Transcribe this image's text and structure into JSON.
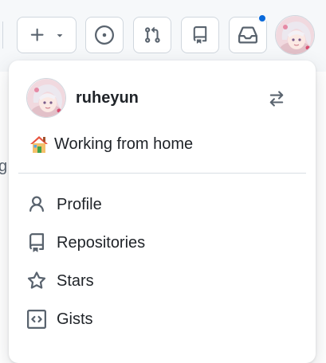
{
  "user": {
    "username": "ruheyun",
    "status": "Working from home",
    "status_emoji": "house-emoji"
  },
  "toolbar": {
    "buttons": [
      {
        "name": "create-new",
        "icon": "plus-icon"
      },
      {
        "name": "issues",
        "icon": "issue-opened-icon"
      },
      {
        "name": "pull-requests",
        "icon": "git-pull-request-icon"
      },
      {
        "name": "repositories",
        "icon": "repo-icon"
      },
      {
        "name": "inbox",
        "icon": "inbox-icon"
      }
    ],
    "notification_dot_color": "#0969da"
  },
  "menu": {
    "items": [
      {
        "label": "Profile",
        "icon": "person-icon"
      },
      {
        "label": "Repositories",
        "icon": "repo-icon"
      },
      {
        "label": "Stars",
        "icon": "star-icon"
      },
      {
        "label": "Gists",
        "icon": "code-square-icon"
      }
    ]
  },
  "colors": {
    "accent": "#0969da",
    "text": "#1f2328",
    "muted": "#59636e",
    "border": "#d0d7de"
  }
}
